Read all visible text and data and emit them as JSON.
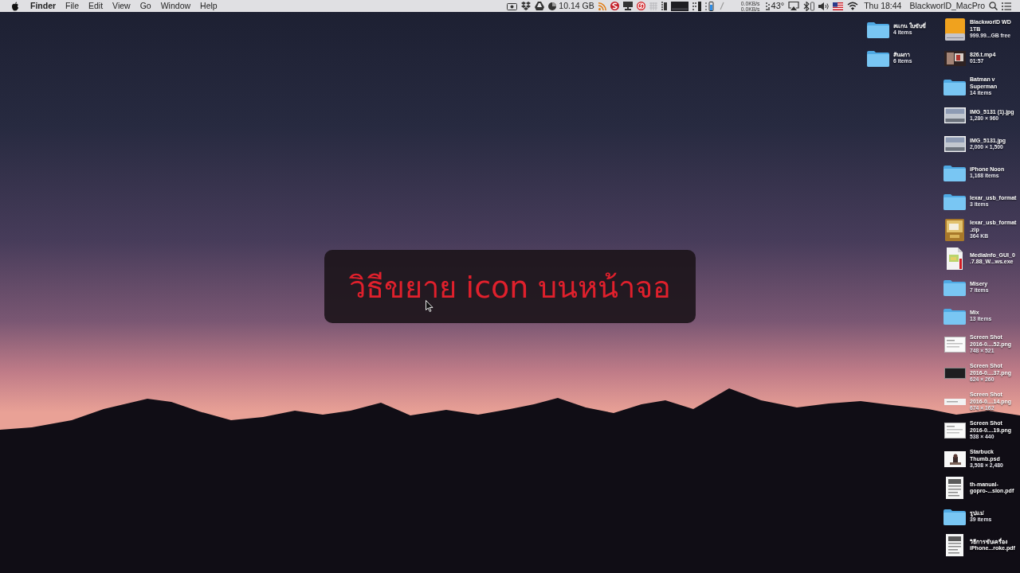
{
  "menu_bar": {
    "app_name": "Finder",
    "menus": [
      "File",
      "Edit",
      "View",
      "Go",
      "Window",
      "Help"
    ],
    "disk_free": "10.14 GB",
    "network_upload": "0.0KB/s",
    "network_download": "0.0KB/s",
    "temperature": "43°",
    "clock": "Thu 18:44",
    "computer_name": "BlackworlD_MacPro"
  },
  "desktop": {
    "left_column": [
      {
        "kind": "folder",
        "lines": [
          "สแกน ใบขับขี่"
        ],
        "detail": "4 items"
      },
      {
        "kind": "folder",
        "lines": [
          "สันผกา"
        ],
        "detail": "6 items"
      }
    ],
    "right_column": [
      {
        "kind": "drive",
        "lines": [
          "BlackworlD WD",
          "1TB"
        ],
        "detail": "999.99...GB free"
      },
      {
        "kind": "video",
        "lines": [
          "826.t.mp4"
        ],
        "detail": "01:57"
      },
      {
        "kind": "folder",
        "lines": [
          "Batman v",
          "Superman"
        ],
        "detail": "14 items"
      },
      {
        "kind": "photo",
        "lines": [
          "IMG_5131 (1).jpg"
        ],
        "detail": "1,280 × 960"
      },
      {
        "kind": "photo",
        "lines": [
          "IMG_5131.jpg"
        ],
        "detail": "2,000 × 1,500"
      },
      {
        "kind": "folder",
        "lines": [
          "iPhone Noon"
        ],
        "detail": "1,168 items"
      },
      {
        "kind": "folder",
        "lines": [
          "lexar_usb_format"
        ],
        "detail": "3 items"
      },
      {
        "kind": "archive",
        "lines": [
          "lexar_usb_format",
          ".zip"
        ],
        "detail": "364 KB"
      },
      {
        "kind": "installer",
        "lines": [
          "MediaInfo_GUI_0",
          ".7.88_W...ws.exe"
        ]
      },
      {
        "kind": "folder",
        "lines": [
          "Misery"
        ],
        "detail": "7 items"
      },
      {
        "kind": "folder",
        "lines": [
          "Mix"
        ],
        "detail": "13 items"
      },
      {
        "kind": "screenshot",
        "lines": [
          "Screen Shot",
          "2016-0....52.png"
        ],
        "detail": "748 × 521"
      },
      {
        "kind": "dark-screenshot",
        "lines": [
          "Screen Shot",
          "2016-0....37.png"
        ],
        "detail": "624 × 260"
      },
      {
        "kind": "wide-screenshot",
        "lines": [
          "Screen Shot",
          "2016-0....14.png"
        ],
        "detail": "674 × 162"
      },
      {
        "kind": "screenshot",
        "lines": [
          "Screen Shot",
          "2016-0....19.png"
        ],
        "detail": "538 × 440"
      },
      {
        "kind": "artwork",
        "lines": [
          "Starbuck",
          "Thumb.psd"
        ],
        "detail": "3,508 × 2,480"
      },
      {
        "kind": "pdf",
        "lines": [
          "th-manual-",
          "gopro-...sion.pdf"
        ]
      },
      {
        "kind": "folder",
        "lines": [
          "รูปแม่"
        ],
        "detail": "39 items"
      },
      {
        "kind": "pdf",
        "lines": [
          "วิธีการขับเครื่อง",
          "iPhone...roke.pdf"
        ]
      }
    ]
  },
  "banner": {
    "text": "วิธีขยาย icon บนหน้าจอ"
  }
}
